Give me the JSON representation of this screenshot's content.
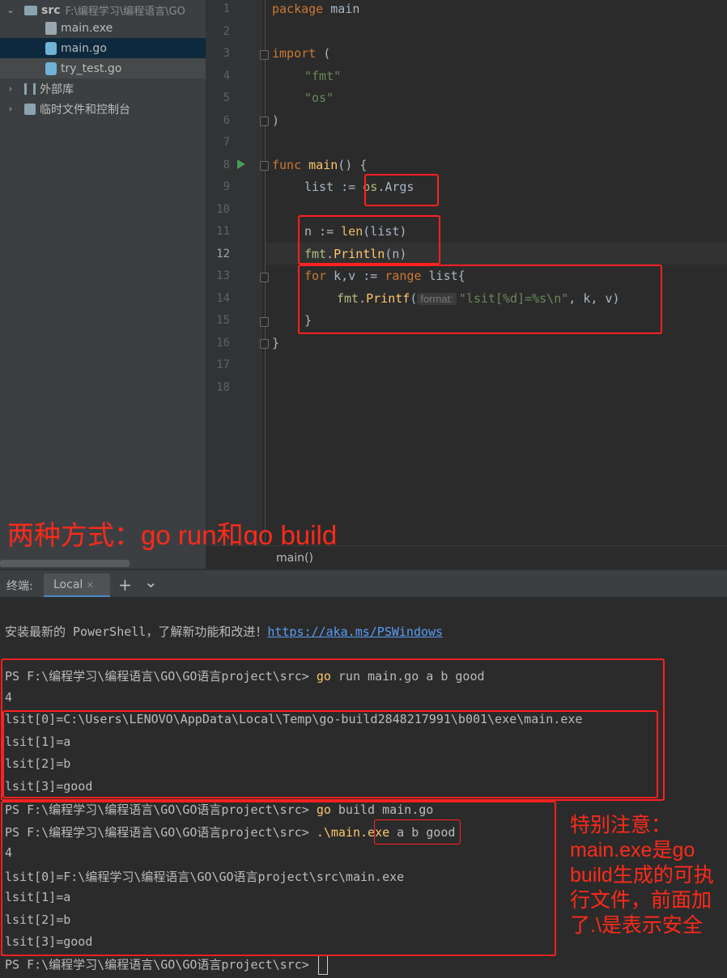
{
  "tree": {
    "root_name": "src",
    "root_path": "F:\\编程学习\\编程语言\\GO",
    "files": [
      "main.exe",
      "main.go",
      "try_test.go"
    ],
    "ext_libs": "外部库",
    "scratches": "临时文件和控制台"
  },
  "editor": {
    "line_numbers": [
      "1",
      "2",
      "3",
      "4",
      "5",
      "6",
      "7",
      "8",
      "9",
      "10",
      "11",
      "12",
      "13",
      "14",
      "15",
      "16",
      "17",
      "18"
    ],
    "code": {
      "l1_kw": "package",
      "l1_rest": " main",
      "l3_kw": "import",
      "l3_rest": " (",
      "l4": "\"fmt\"",
      "l5": "\"os\"",
      "l6": ")",
      "l8_kw": "func",
      "l8_fn": "main",
      "l8_rest": "() {",
      "l9_a": "list := ",
      "l9_b": "os",
      "l9_c": ".Args",
      "l11_a": "n := ",
      "l11_fn": "len",
      "l11_b": "(list)",
      "l12_pkg": "fmt",
      "l12_a": ".",
      "l12_fn": "Println",
      "l12_b": "(n)",
      "l13_kw": "for",
      "l13_a": " k,v := ",
      "l13_kw2": "range",
      "l13_b": " list{",
      "l14_pkg": "fmt",
      "l14_a": ".",
      "l14_fn": "Printf",
      "l14_b": "(",
      "l14_hint": "format:",
      "l14_str": "\"lsit[%d]=%s\\n\"",
      "l14_c": ", k, v)",
      "l15": "}",
      "l16": "}"
    },
    "breadcrumb": "main()"
  },
  "annotation_top": "两种方式：go run和go build",
  "annotation_side": [
    "特别注意：",
    "main.exe是go",
    "build生成的可执",
    "行文件，前面加",
    "了.\\是表示安全"
  ],
  "terminal": {
    "label": "终端:",
    "tab": "Local",
    "close": "×",
    "add": "+",
    "dropdown": "⌄",
    "banner_text": "安装最新的 PowerShell，了解新功能和改进！",
    "banner_link": "https://aka.ms/PSWindows",
    "prompt": "PS F:\\编程学习\\编程语言\\GO\\GO语言project\\src> ",
    "cmd1": "go",
    "cmd1_rest": " run main.go a b good",
    "out1": [
      "4",
      "lsit[0]=C:\\Users\\LENOVO\\AppData\\Local\\Temp\\go-build2848217991\\b001\\exe\\main.exe",
      "lsit[1]=a",
      "lsit[2]=b",
      "lsit[3]=good"
    ],
    "cmd2": "go",
    "cmd2_rest": " build main.go",
    "cmd3": ".\\main.exe",
    "cmd3_rest": " a b good",
    "out2": [
      "4",
      "lsit[0]=F:\\编程学习\\编程语言\\GO\\GO语言project\\src\\main.exe",
      "lsit[1]=a",
      "lsit[2]=b",
      "lsit[3]=good"
    ]
  }
}
